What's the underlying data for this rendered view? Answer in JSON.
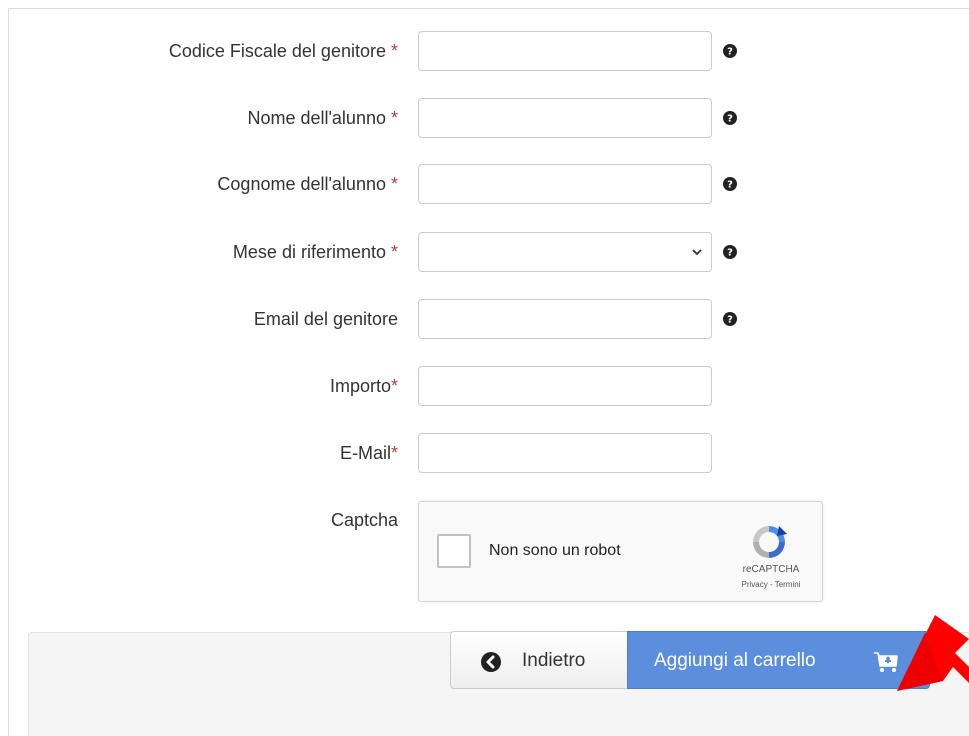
{
  "form": {
    "fields": [
      {
        "label": "Codice Fiscale del genitore",
        "required_mark": " *",
        "type": "text",
        "value": ""
      },
      {
        "label": "Nome dell'alunno",
        "required_mark": " *",
        "type": "text",
        "value": ""
      },
      {
        "label": "Cognome dell'alunno",
        "required_mark": " *",
        "type": "text",
        "value": ""
      },
      {
        "label": "Mese di riferimento",
        "required_mark": " *",
        "type": "select",
        "selected": ""
      },
      {
        "label": "Email del genitore",
        "required_mark": "",
        "type": "text",
        "value": ""
      },
      {
        "label": "Importo",
        "required_mark": "*",
        "type": "text",
        "value": ""
      },
      {
        "label": "E-Mail",
        "required_mark": "*",
        "type": "text",
        "value": ""
      }
    ],
    "captcha": {
      "label": "Captcha",
      "checkbox_text": "Non sono un robot",
      "brand": "reCAPTCHA",
      "links": "Privacy - Termini",
      "checked": false
    }
  },
  "actions": {
    "back_label": "Indietro",
    "add_to_cart_label": "Aggiungi al carrello"
  },
  "icons": {
    "help": "question-circle-icon",
    "back": "chevron-left-circle-icon",
    "cart": "cart-plus-icon",
    "annotation": "red-arrow-icon"
  },
  "colors": {
    "required": "#a94442",
    "primary_button": "#5b8fdd",
    "annotation_arrow": "#ff0000"
  }
}
